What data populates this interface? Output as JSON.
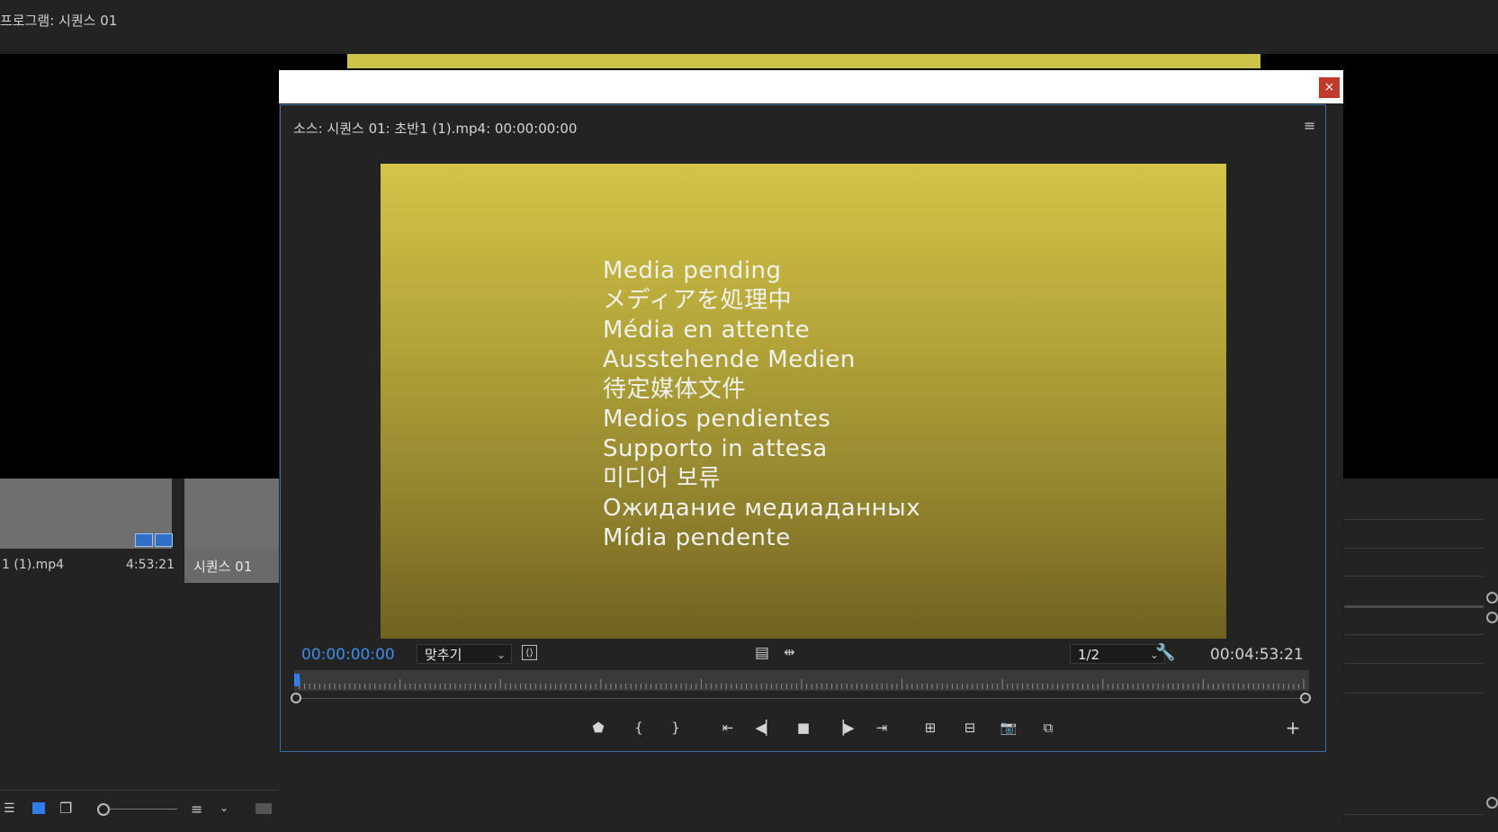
{
  "program_monitor": {
    "title": "프로그램: 시퀀스 01"
  },
  "project_panel": {
    "clip": {
      "name": "1 (1).mp4",
      "duration": "4:53:21"
    },
    "sequence": {
      "name": "시퀀스 01"
    }
  },
  "dialog": {
    "close_label": "×"
  },
  "source_monitor": {
    "title": "소스: 시퀀스 01: 초반1 (1).mp4: 00:00:00:00",
    "menu_icon": "hamburger-menu-icon",
    "pending_lines": [
      "Media pending",
      "メディアを処理中",
      "Média en attente",
      "Ausstehende Medien",
      "待定媒体文件",
      "Medios pendientes",
      "Supporto in attesa",
      "미디어 보류",
      "Ожидание медиаданных",
      "Mídia pendente"
    ],
    "timecode": "00:00:00:00",
    "fit_value": "맞추기",
    "resolution_value": "1/2",
    "duration": "00:04:53:21",
    "playhead_fraction": 0.0,
    "accent_color": "#3b8fe9"
  }
}
